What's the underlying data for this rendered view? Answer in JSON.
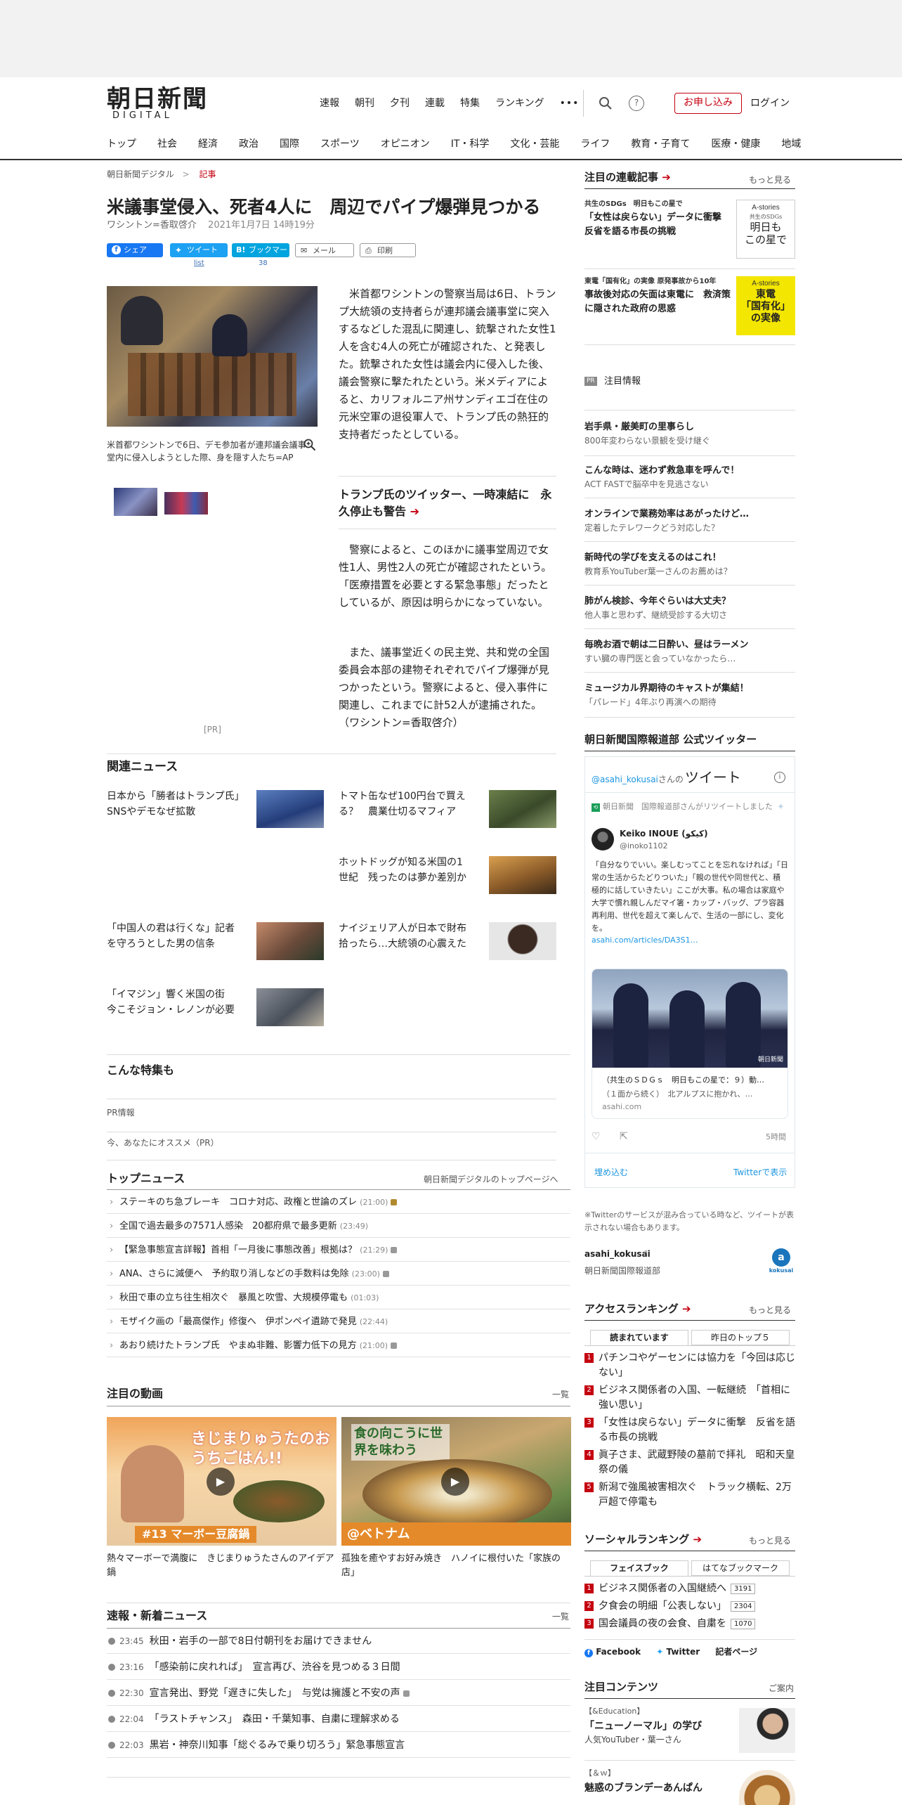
{
  "header": {
    "logo_main": "朝日新聞",
    "logo_sub": "DIGITAL",
    "top_nav": [
      "速報",
      "朝刊",
      "夕刊",
      "連載",
      "特集",
      "ランキング"
    ],
    "more": "•••",
    "apply": "お申し込み",
    "login": "ログイン",
    "categories": [
      "トップ",
      "社会",
      "経済",
      "政治",
      "国際",
      "スポーツ",
      "オピニオン",
      "IT・科学",
      "文化・芸能",
      "ライフ",
      "教育・子育て",
      "医療・健康",
      "地域"
    ]
  },
  "breadcrumb": {
    "home": "朝日新聞デジタル",
    "sep": ">",
    "current": "記事"
  },
  "article": {
    "title": "米議事堂侵入、死者4人に　周辺でパイプ爆弾見つかる",
    "byline": "ワシントン=香取啓介",
    "date": "2021年1月7日 14時19分",
    "share": {
      "facebook": "シェア",
      "twitter": "ツイート",
      "twitter_list": "list",
      "hatena": "ブックマーク",
      "hatena_count": "38",
      "mail": "メール",
      "print": "印刷"
    },
    "photo_caption": "米首都ワシントンで6日、デモ参加者が連邦議会議事堂内に侵入しようとした際、身を隠す人たち=AP",
    "pr": "[PR]",
    "p1": "米首都ワシントンの警察当局は6日、トランプ大統領の支持者らが連邦議会議事堂に突入するなどした混乱に関連し、銃撃された女性1人を含む4人の死亡が確認された、と発表した。銃撃された女性は議会内に侵入した後、議会警察に撃たれたという。米メディアによると、カリフォルニア州サンディエゴ在住の元米空軍の退役軍人で、トランプ氏の熱狂的支持者だったとしている。",
    "sub_link": "トランプ氏のツイッター、一時凍結に　永久停止も警告",
    "p2": "警察によると、このほかに議事堂周辺で女性1人、男性2人の死亡が確認されたという。「医療措置を必要とする緊急事態」だったとしているが、原因は明らかになっていない。",
    "p3": "また、議事堂近くの民主党、共和党の全国委員会本部の建物それぞれでパイプ爆弾が見つかったという。警察によると、侵入事件に関連し、これまでに計52人が逮捕された。（ワシントン=香取啓介）"
  },
  "related": {
    "heading": "関連ニュース",
    "items": [
      "日本から「勝者はトランプ氏」　SNSやデモなぜ拡散",
      "トマト缶なぜ100円台で買える？　農業仕切るマフィア",
      "ホットドッグが知る米国の1世紀　残ったのは夢か差別か",
      "「中国人の君は行くな」記者を守ろうとした男の信条",
      "ナイジェリア人が日本で財布拾ったら…大統領の心震えた",
      "「イマジン」響く米国の街　今こそジョン・レノンが必要"
    ]
  },
  "special": {
    "heading": "こんな特集も",
    "pr_info": "PR情報",
    "recommend": "今、あなたにオススメ（PR）"
  },
  "top_news": {
    "heading": "トップニュース",
    "link": "朝日新聞デジタルのトップページへ",
    "items": [
      {
        "title": "ステーキのち急ブレーキ　コロナ対応、政権と世論のズレ",
        "time": "(21:00)"
      },
      {
        "title": "全国で過去最多の7571人感染　20都府県で最多更新",
        "time": "(23:49)"
      },
      {
        "title": "【緊急事態宣言詳報】首相「一月後に事態改善」根拠は？",
        "time": "(21:29)"
      },
      {
        "title": "ANA、さらに減便へ　予約取り消しなどの手数料は免除",
        "time": "(23:00)"
      },
      {
        "title": "秋田で車の立ち往生相次ぐ　暴風と吹雪、大規模停電も",
        "time": "(01:03)"
      },
      {
        "title": "モザイク画の「最高傑作」修復へ　伊ポンペイ遺跡で発見",
        "time": "(22:44)"
      },
      {
        "title": "あおり続けたトランプ氏　やまぬ非難、影響力低下の見方",
        "time": "(21:00)"
      }
    ]
  },
  "videos": {
    "heading": "注目の動画",
    "list_link": "一覧",
    "items": [
      {
        "overlay_title": "きじまりゅうたのおうちごはん!!",
        "overlay_badge": "#13 マーボー豆腐鍋",
        "caption": "熱々マーボーで満腹に　きじまりゅうたさんのアイデア鍋"
      },
      {
        "overlay_title": "食の向こうに世界を味わう",
        "overlay_badge": "@ベトナム",
        "caption": "孤独を癒やすお好み焼き　ハノイに根付いた「家族の店」"
      }
    ]
  },
  "breaking": {
    "heading": "速報・新着ニュース",
    "list_link": "一覧",
    "items": [
      {
        "time": "23:45",
        "title": "秋田・岩手の一部で8日付朝刊をお届けできません"
      },
      {
        "time": "23:16",
        "title": "「感染前に戻れれば」　宣言再び、渋谷を見つめる３日間"
      },
      {
        "time": "22:30",
        "title": "宣言発出、野党「遅きに失した」　与党は擁護と不安の声"
      },
      {
        "time": "22:04",
        "title": "「ラストチャンス」　森田・千葉知事、自粛に理解求める"
      },
      {
        "time": "22:03",
        "title": "黒岩・神奈川知事「総ぐるみで乗り切ろう」緊急事態宣言"
      }
    ]
  },
  "sidebar": {
    "series": {
      "heading": "注目の連載記事",
      "more": "もっと見る",
      "items": [
        {
          "label": "共生のSDGs　明日もこの星で",
          "title": "「女性は戻らない」データに衝撃　反省を語る市長の挑戦",
          "badge_top": "A-stories",
          "badge_mid": "共生のSDGs",
          "badge_main": "明日も\nこの星で"
        },
        {
          "label": "東電「国有化」の実像 原発事故から10年",
          "title": "事故後対応の矢面は東電に　救済策に隠された政府の思惑",
          "badge_top": "A-stories",
          "badge_main": "東電\n「国有化」\nの実像"
        }
      ]
    },
    "pr": {
      "tag": "PR",
      "heading": "注目情報",
      "items": [
        {
          "title": "岩手県・厳美町の里事らし",
          "sub": "800年変わらない景観を受け継ぐ"
        },
        {
          "title": "こんな時は、迷わず救急車を呼んで！",
          "sub": "ACT FASTで脳卒中を見逃さない"
        },
        {
          "title": "オンラインで業務効率はあがったけど…",
          "sub": "定着したテレワークどう対応した？"
        },
        {
          "title": "新時代の学びを支えるのはこれ！",
          "sub": "教育系YouTuber葉一さんのお薦めは？"
        },
        {
          "title": "肺がん検診、今年ぐらいは大丈夫？",
          "sub": "他人事と思わず、継続受診する大切さ"
        },
        {
          "title": "毎晩お酒で朝は二日酔い、昼はラーメン",
          "sub": "すい臓の専門医と会っていなかったら…"
        },
        {
          "title": "ミュージカル界期待のキャストが集結！",
          "sub": "「パレード」4年ぶり再演への期待"
        }
      ]
    },
    "twitter": {
      "heading": "朝日新聞国際報道部 公式ツイッター",
      "handle": "@asahi_kokusai",
      "handle_suffix": "さんの",
      "tweet_word": "ツイート",
      "retweet_note": "朝日新聞　国際報道部さんがリツイートしました",
      "user_name": "Keiko INOUE (كيكو)",
      "user_handle": "@inoko1102",
      "tweet_text": "「自分なりでいい。楽しむってことを忘れなければ」「日常の生活からたどりついた」「親の世代や同世代と、積極的に話していきたい」ここが大事。私の場合は家庭や大学で慣れ親しんだマイ箸・カップ・バッグ、プラ容器再利用、世代を超えて楽しんで、生活の一部にし、変化を。",
      "tweet_link": "asahi.com/articles/DA3S1…",
      "card_title": "（共生のＳＤＧｓ　明日もこの星で：９）動…",
      "card_desc": "（１面から続く）　北アルプスに抱かれ、…",
      "card_domain": "asahi.com",
      "card_overlay": "朝日新聞",
      "time": "5時間",
      "embed": "埋め込む",
      "view_on": "Twitterで表示",
      "note": "※Twitterのサービスが混み合っている時など、ツイートが表示されない場合もあります。",
      "account": "asahi_kokusai",
      "account_desc": "朝日新聞国際報道部",
      "logo": "kokusai"
    },
    "access_ranking": {
      "heading": "アクセスランキング",
      "more": "もっと見る",
      "tab_active": "読まれています",
      "tab_other": "昨日のトップ５",
      "items": [
        "パチンコやゲーセンには協力を「今回は応じない」",
        "ビジネス関係者の入国、一転継続　「首相に強い思い」",
        "「女性は戻らない」データに衝撃　反省を語る市長の挑戦",
        "眞子さま、武蔵野陵の墓前で拝礼　昭和天皇祭の儀",
        "新潟で強風被害相次ぐ　トラック横転、2万戸超で停電も"
      ]
    },
    "social_ranking": {
      "heading": "ソーシャルランキング",
      "more": "もっと見る",
      "tab_active": "フェイスブック",
      "tab_other": "はてなブックマーク",
      "items": [
        {
          "title": "ビジネス関係者の入国継続へ",
          "count": "3191"
        },
        {
          "title": "夕食会の明細「公表しない」",
          "count": "2304"
        },
        {
          "title": "国会議員の夜の会食、自粛を",
          "count": "1070"
        }
      ],
      "facebook": "Facebook",
      "twitter": "Twitter",
      "writers": "記者ページ"
    },
    "contents": {
      "heading": "注目コンテンツ",
      "guide": "ご案内",
      "items": [
        {
          "label": "【&Education】",
          "title": "「ニューノーマル」の学び",
          "sub": "人気YouTuber・葉一さん"
        },
        {
          "label": "【＆ｗ】",
          "title": "魅惑のブランデーあんぱん"
        }
      ]
    }
  }
}
